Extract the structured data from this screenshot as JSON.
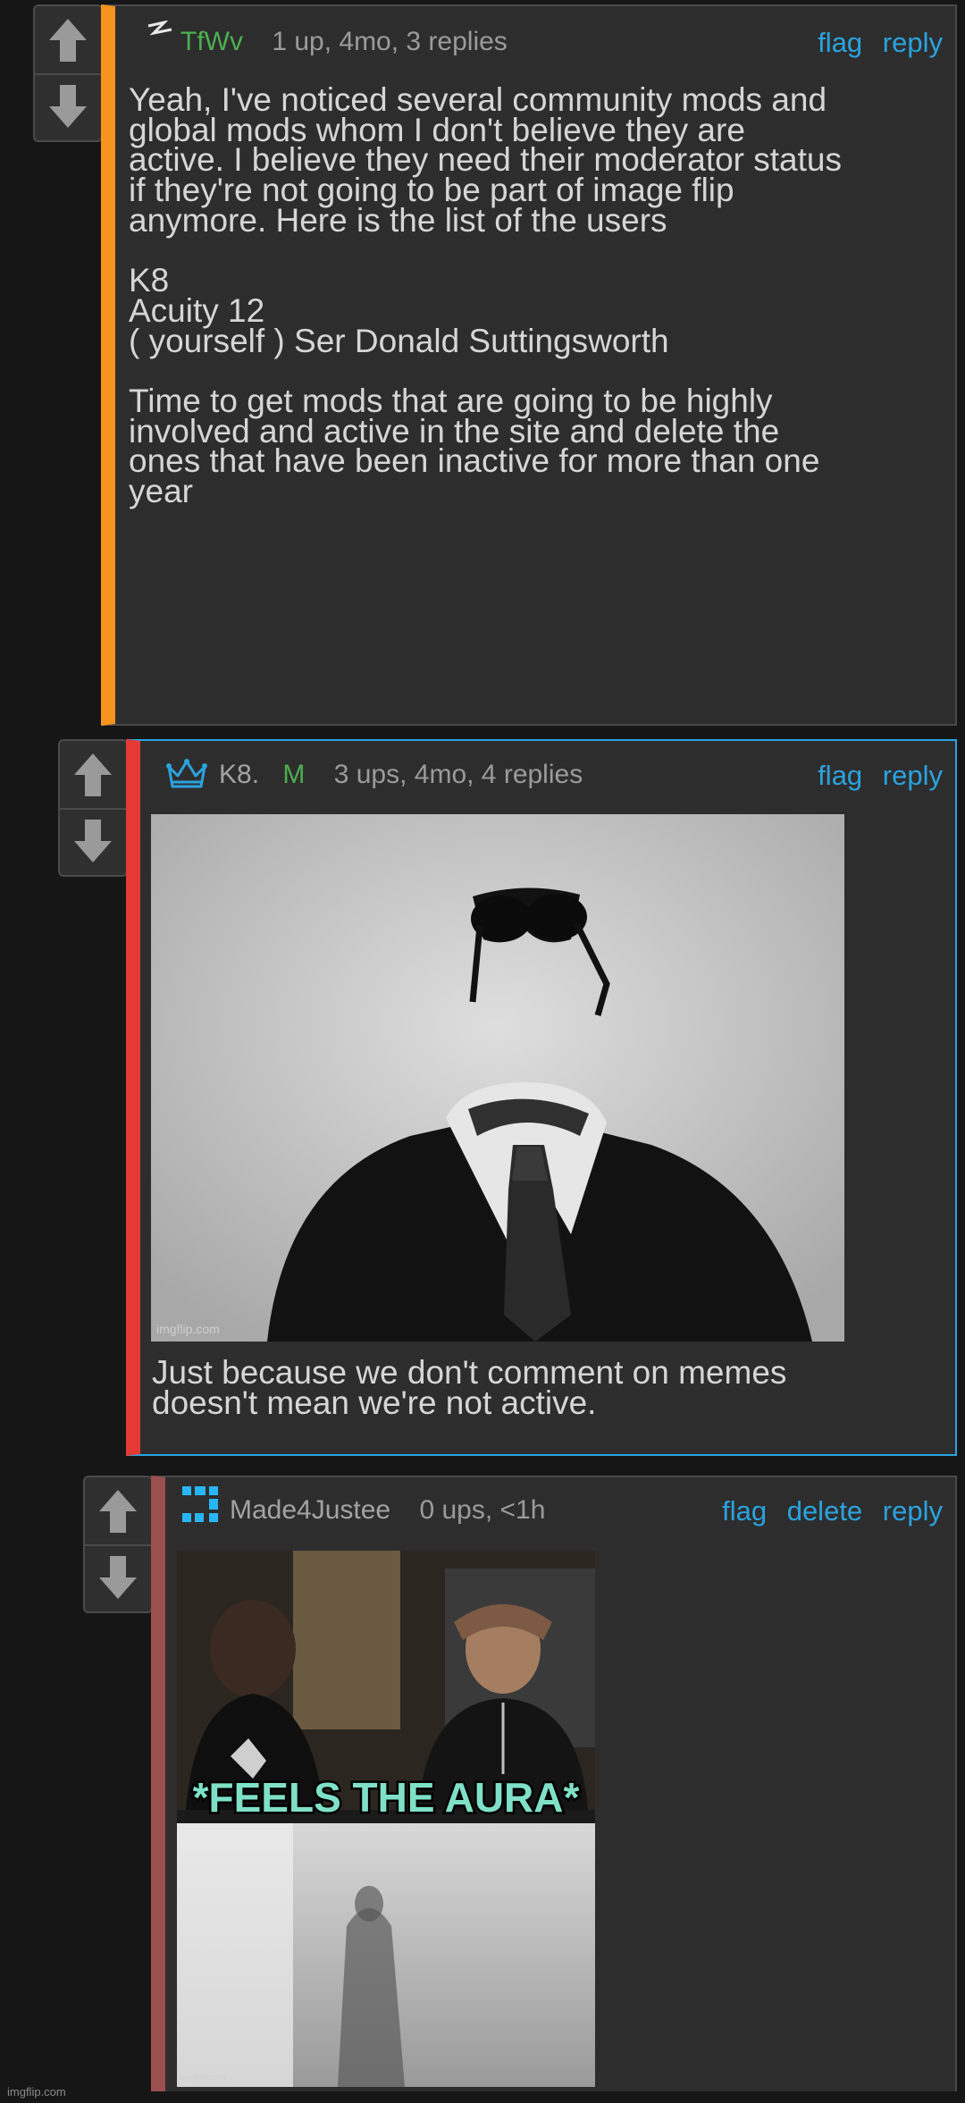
{
  "comments": [
    {
      "username": "TfWv",
      "meta": "1 up, 4mo, 3 replies",
      "actions": {
        "flag": "flag",
        "reply": "reply"
      },
      "body": "Yeah, I've noticed several community mods and\nglobal mods whom I don't believe they are\nactive. I believe they need their moderator status\nif they're not going to be part of image flip\nanymore. Here is the list of the users\n\nK8\nAcuity 12\n( yourself ) Ser Donald Suttingsworth\n\nTime to get mods that are going to be highly\ninvolved and active in the site and delete the\nones that have been inactive for more than one\nyear",
      "accent_color": "#f7941d",
      "icon": "lightning-badge-icon"
    },
    {
      "username": "K8.",
      "mod_badge": "M",
      "meta": "3 ups, 4mo, 4 replies",
      "actions": {
        "flag": "flag",
        "reply": "reply"
      },
      "image_watermark": "imgflip.com",
      "body": "Just because we don't comment on memes\ndoesn't mean we're not active.",
      "accent_color": "#e53935",
      "border_color": "#2aa3df",
      "icon": "crown-icon"
    },
    {
      "username": "Made4Justee",
      "meta": "0 ups, <1h",
      "actions": {
        "flag": "flag",
        "delete": "delete",
        "reply": "reply"
      },
      "image_caption": "*FEELS THE AURA*",
      "image_watermark": "imgflip.com",
      "accent_color": "#9c4f4f",
      "icon": "pixel-avatar-icon"
    }
  ],
  "page_watermark": "imgflip.com",
  "colors": {
    "link": "#2aa3df",
    "mod_badge": "#4caf50",
    "username_green": "#4caf50"
  }
}
